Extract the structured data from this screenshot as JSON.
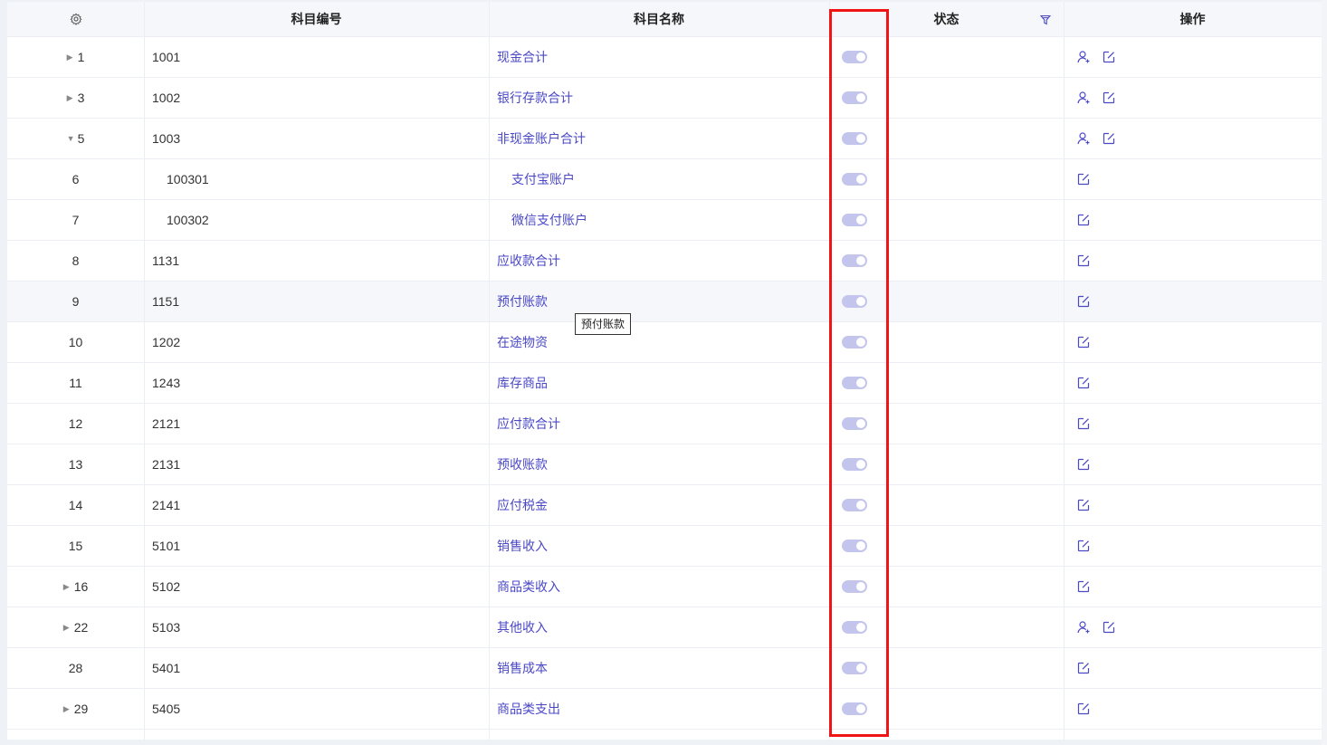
{
  "header": {
    "col_code": "科目编号",
    "col_name": "科目名称",
    "col_status": "状态",
    "col_ops": "操作"
  },
  "rows": [
    {
      "idx": "1",
      "code": "1001",
      "name": "现金合计",
      "caret": "right",
      "level": 0,
      "ops": [
        "user",
        "edit"
      ]
    },
    {
      "idx": "3",
      "code": "1002",
      "name": "银行存款合计",
      "caret": "right",
      "level": 0,
      "ops": [
        "user",
        "edit"
      ]
    },
    {
      "idx": "5",
      "code": "1003",
      "name": "非现金账户合计",
      "caret": "down",
      "level": 0,
      "ops": [
        "user",
        "edit"
      ]
    },
    {
      "idx": "6",
      "code": "100301",
      "name": "支付宝账户",
      "caret": "",
      "level": 1,
      "ops": [
        "edit"
      ]
    },
    {
      "idx": "7",
      "code": "100302",
      "name": "微信支付账户",
      "caret": "",
      "level": 1,
      "ops": [
        "edit"
      ]
    },
    {
      "idx": "8",
      "code": "1131",
      "name": "应收款合计",
      "caret": "",
      "level": 0,
      "ops": [
        "edit"
      ]
    },
    {
      "idx": "9",
      "code": "1151",
      "name": "预付账款",
      "caret": "",
      "level": 0,
      "ops": [
        "edit"
      ],
      "hover": true
    },
    {
      "idx": "10",
      "code": "1202",
      "name": "在途物资",
      "caret": "",
      "level": 0,
      "ops": [
        "edit"
      ]
    },
    {
      "idx": "11",
      "code": "1243",
      "name": "库存商品",
      "caret": "",
      "level": 0,
      "ops": [
        "edit"
      ]
    },
    {
      "idx": "12",
      "code": "2121",
      "name": "应付款合计",
      "caret": "",
      "level": 0,
      "ops": [
        "edit"
      ]
    },
    {
      "idx": "13",
      "code": "2131",
      "name": "预收账款",
      "caret": "",
      "level": 0,
      "ops": [
        "edit"
      ]
    },
    {
      "idx": "14",
      "code": "2141",
      "name": "应付税金",
      "caret": "",
      "level": 0,
      "ops": [
        "edit"
      ]
    },
    {
      "idx": "15",
      "code": "5101",
      "name": "销售收入",
      "caret": "",
      "level": 0,
      "ops": [
        "edit"
      ]
    },
    {
      "idx": "16",
      "code": "5102",
      "name": "商品类收入",
      "caret": "right",
      "level": 0,
      "ops": [
        "edit"
      ]
    },
    {
      "idx": "22",
      "code": "5103",
      "name": "其他收入",
      "caret": "right",
      "level": 0,
      "ops": [
        "user",
        "edit"
      ]
    },
    {
      "idx": "28",
      "code": "5401",
      "name": "销售成本",
      "caret": "",
      "level": 0,
      "ops": [
        "edit"
      ]
    },
    {
      "idx": "29",
      "code": "5405",
      "name": "商品类支出",
      "caret": "right",
      "level": 0,
      "ops": [
        "edit"
      ]
    }
  ],
  "tooltip": {
    "text": "预付账款"
  },
  "colors": {
    "accent": "#4b48c6",
    "switch_on": "#c3c5ec",
    "highlight": "#f01414"
  }
}
